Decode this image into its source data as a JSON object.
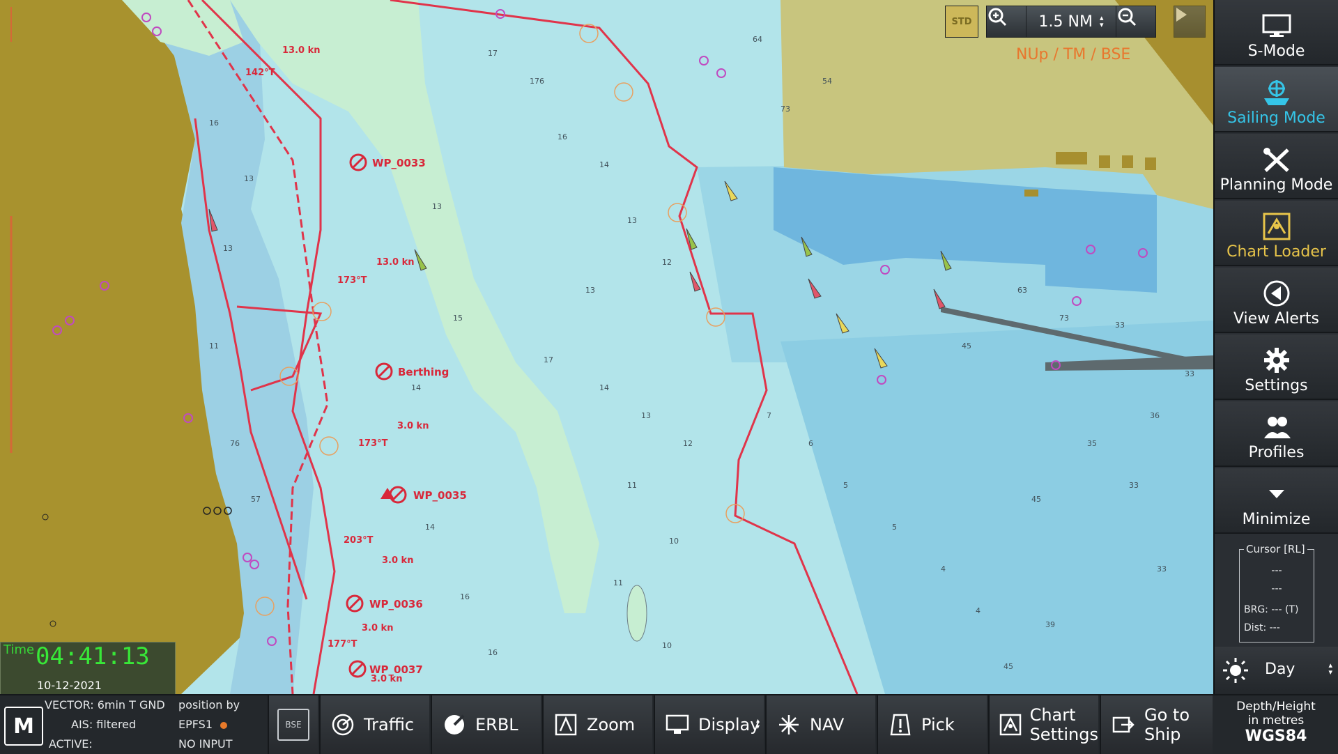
{
  "top": {
    "scale_value": "1.5 NM",
    "std_label": "STD",
    "orientation": "NUp / TM / BSE"
  },
  "sidebar": {
    "items": [
      {
        "label": "S-Mode",
        "icon": "monitor-icon"
      },
      {
        "label": "Sailing Mode",
        "icon": "ship-helm-icon"
      },
      {
        "label": "Planning Mode",
        "icon": "planning-tools-icon"
      },
      {
        "label": "Chart Loader",
        "icon": "chart-loader-icon"
      },
      {
        "label": "View Alerts",
        "icon": "alert-bell-icon"
      },
      {
        "label": "Settings",
        "icon": "gear-icon"
      },
      {
        "label": "Profiles",
        "icon": "people-icon"
      },
      {
        "label": "Minimize",
        "icon": "chevron-down-icon"
      }
    ],
    "cursor": {
      "title": "Cursor [RL]",
      "line1": "---",
      "line2": "---",
      "brg": "BRG: --- (T)",
      "dist": "Dist: ---"
    },
    "day_mode": "Day",
    "depth_units": {
      "line1": "Depth/Height",
      "line2": "in metres",
      "datum": "WGS84"
    }
  },
  "clock": {
    "label": "Time",
    "value": "04:41:13",
    "date": "10-12-2021"
  },
  "status": {
    "vector": "VECTOR: 6min T GND",
    "ais": "AIS: filtered",
    "active": "ACTIVE:",
    "position_by": "position by",
    "sensor": "EPFS1",
    "input": "NO INPUT"
  },
  "bottom": {
    "buttons": [
      {
        "label": "Traffic",
        "icon": "traffic-icon"
      },
      {
        "label": "ERBL",
        "icon": "erbl-icon"
      },
      {
        "label": "Zoom",
        "icon": "zoom-frame-icon"
      },
      {
        "label": "Display",
        "icon": "display-monitor-icon"
      },
      {
        "label": "NAV",
        "icon": "nav-star-icon"
      },
      {
        "label": "Pick",
        "icon": "pick-icon"
      },
      {
        "label": "Chart\nSettings",
        "label1": "Chart",
        "label2": "Settings",
        "icon": "chart-settings-icon"
      },
      {
        "label": "Go to Ship",
        "label1": "Go to",
        "label2": "Ship",
        "icon": "go-to-ship-icon"
      }
    ],
    "bse_label": "BSE"
  },
  "route": {
    "waypoints": [
      "WP_0033",
      "Berthing",
      "WP_0035",
      "WP_0036",
      "WP_0037"
    ],
    "speeds": [
      "13.0 kn",
      "13.0 kn",
      "3.0 kn",
      "3.0 kn",
      "3.0 kn",
      "3.0 kn"
    ],
    "courses": [
      "142°T",
      "173°T",
      "173°T",
      "203°T",
      "177°T"
    ]
  },
  "colors": {
    "sea_deep": "#9fd6e0",
    "sea_shallow": "#bfe8ee",
    "land": "#b7a244",
    "land_dark": "#8f7d2a",
    "route": "#e0344a",
    "active_blue": "#35c5e8",
    "chart_loader_yellow": "#e8c54a"
  }
}
